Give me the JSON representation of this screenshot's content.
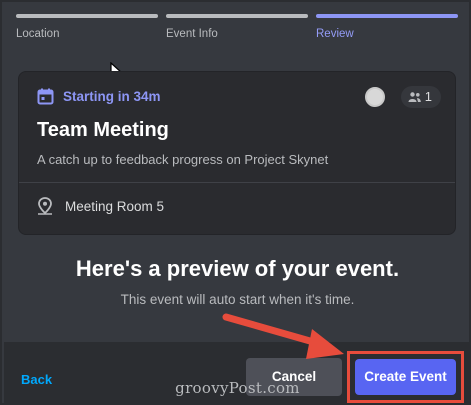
{
  "steps": [
    {
      "label": "Location",
      "active": false
    },
    {
      "label": "Event Info",
      "active": false
    },
    {
      "label": "Review",
      "active": true
    }
  ],
  "event_card": {
    "starting_label": "Starting in 34m",
    "interested_count": "1",
    "title": "Team Meeting",
    "description": "A catch up to feedback progress on Project Skynet",
    "location": "Meeting Room 5",
    "icons": {
      "calendar": "calendar-icon",
      "people": "people-icon",
      "location": "location-pin-icon"
    }
  },
  "preview": {
    "heading": "Here's a preview of your event.",
    "subtext": "This event will auto start when it's time."
  },
  "footer": {
    "back_label": "Back",
    "cancel_label": "Cancel",
    "create_label": "Create Event"
  },
  "watermark": "groovyPost.com",
  "colors": {
    "accent": "#5865f2",
    "step_active": "#8d96f5",
    "link": "#00a8fc",
    "highlight": "#e74c3c"
  }
}
